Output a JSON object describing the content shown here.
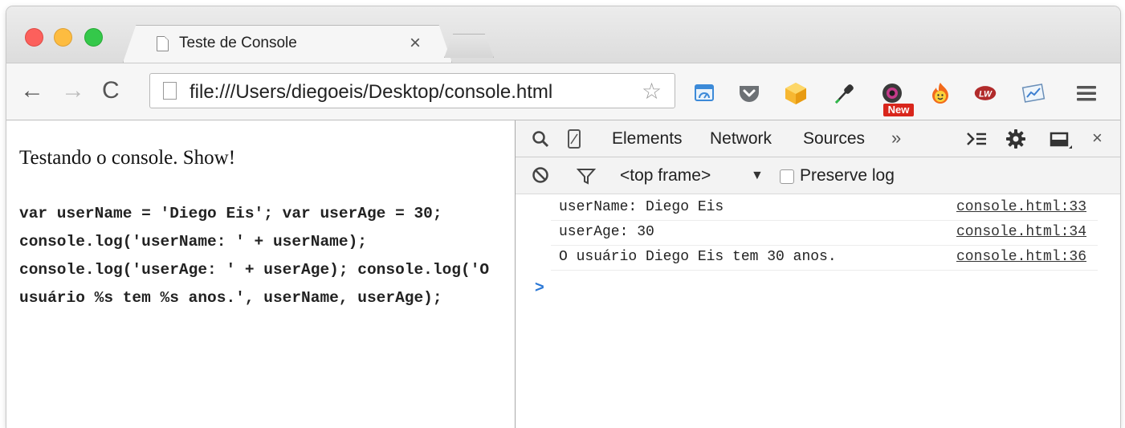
{
  "window": {
    "tab_title": "Teste de Console",
    "tab_close": "×"
  },
  "toolbar": {
    "back": "←",
    "forward": "→",
    "reload": "C",
    "url": "file:///Users/diegoeis/Desktop/console.html",
    "star": "☆",
    "extensions": [
      "cast-icon",
      "pocket-icon",
      "box-icon",
      "eyedropper-icon",
      "camera-new-icon",
      "hola-fire-icon",
      "lastpass-lw-icon",
      "chart-icon"
    ],
    "new_badge": "New"
  },
  "page": {
    "heading": "Testando o console. Show!",
    "code": "var userName = 'Diego Eis'; var userAge = 30; console.log('userName: ' + userName); console.log('userAge: ' + userAge); console.log('O usuário %s tem %s anos.', userName, userAge);"
  },
  "devtools": {
    "tabs": [
      "Elements",
      "Network",
      "Sources"
    ],
    "more": "»",
    "close": "×",
    "frame": "<top frame>",
    "caret": "▼",
    "preserve_log": "Preserve log",
    "log": [
      {
        "message": "userName: Diego Eis",
        "source": "console.html:33"
      },
      {
        "message": "userAge: 30",
        "source": "console.html:34"
      },
      {
        "message": "O usuário Diego Eis tem 30 anos.",
        "source": "console.html:36"
      }
    ],
    "prompt": ">"
  },
  "colors": {
    "close": "#fc605c",
    "minimize": "#fdbc40",
    "zoom": "#34c84a",
    "prompt": "#2b78d6",
    "new_badge": "#d9261c"
  }
}
